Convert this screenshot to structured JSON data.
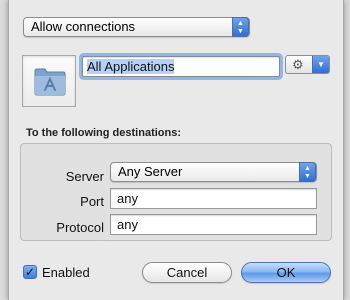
{
  "action_popup": {
    "value": "Allow connections"
  },
  "application": {
    "name": "All Applications"
  },
  "destinations": {
    "title": "To the following destinations:",
    "server": {
      "label": "Server",
      "value": "Any Server"
    },
    "port": {
      "label": "Port",
      "value": "any"
    },
    "protocol": {
      "label": "Protocol",
      "value": "any"
    }
  },
  "enabled": {
    "label": "Enabled",
    "checked": true
  },
  "buttons": {
    "cancel": "Cancel",
    "ok": "OK"
  },
  "icons": {
    "application": "applications-folder-icon",
    "gear": "gear-icon",
    "checkmark": "checkmark-icon"
  },
  "colors": {
    "accent": "#3b7fe0",
    "focus_ring": "#8fb6ee",
    "selection": "#b5d2f6"
  }
}
